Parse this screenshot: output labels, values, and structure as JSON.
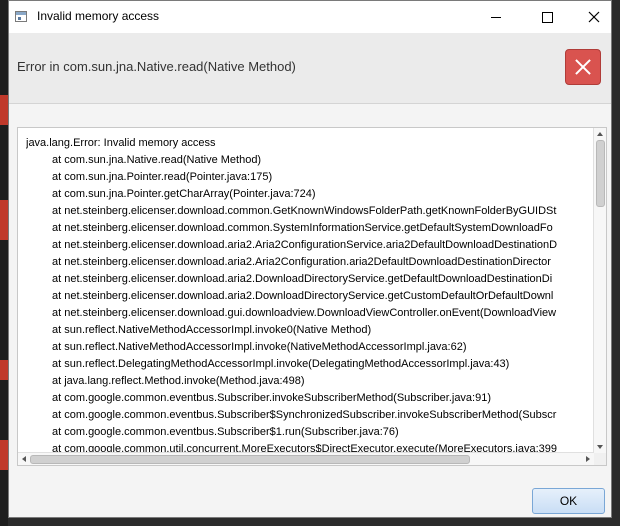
{
  "window": {
    "title": "Invalid memory access"
  },
  "header": {
    "message": "Error in com.sun.jna.Native.read(Native Method)"
  },
  "icons": {
    "error": "error-x-icon"
  },
  "colors": {
    "error_icon": "#d9534f",
    "ok_button_border": "#7aa7d6"
  },
  "trace": {
    "lines": [
      "java.lang.Error: Invalid memory access",
      "at com.sun.jna.Native.read(Native Method)",
      "at com.sun.jna.Pointer.read(Pointer.java:175)",
      "at com.sun.jna.Pointer.getCharArray(Pointer.java:724)",
      "at net.steinberg.elicenser.download.common.GetKnownWindowsFolderPath.getKnownFolderByGUIDSt",
      "at net.steinberg.elicenser.download.common.SystemInformationService.getDefaultSystemDownloadFo",
      "at net.steinberg.elicenser.download.aria2.Aria2ConfigurationService.aria2DefaultDownloadDestinationD",
      "at net.steinberg.elicenser.download.aria2.Aria2Configuration.aria2DefaultDownloadDestinationDirector",
      "at net.steinberg.elicenser.download.aria2.DownloadDirectoryService.getDefaultDownloadDestinationDi",
      "at net.steinberg.elicenser.download.aria2.DownloadDirectoryService.getCustomDefaultOrDefaultDownl",
      "at net.steinberg.elicenser.download.gui.downloadview.DownloadViewController.onEvent(DownloadView",
      "at sun.reflect.NativeMethodAccessorImpl.invoke0(Native Method)",
      "at sun.reflect.NativeMethodAccessorImpl.invoke(NativeMethodAccessorImpl.java:62)",
      "at sun.reflect.DelegatingMethodAccessorImpl.invoke(DelegatingMethodAccessorImpl.java:43)",
      "at java.lang.reflect.Method.invoke(Method.java:498)",
      "at com.google.common.eventbus.Subscriber.invokeSubscriberMethod(Subscriber.java:91)",
      "at com.google.common.eventbus.Subscriber$SynchronizedSubscriber.invokeSubscriberMethod(Subscr",
      "at com.google.common.eventbus.Subscriber$1.run(Subscriber.java:76)",
      "at com.google.common.util.concurrent.MoreExecutors$DirectExecutor.execute(MoreExecutors.java:399"
    ]
  },
  "buttons": {
    "ok_label": "OK"
  }
}
